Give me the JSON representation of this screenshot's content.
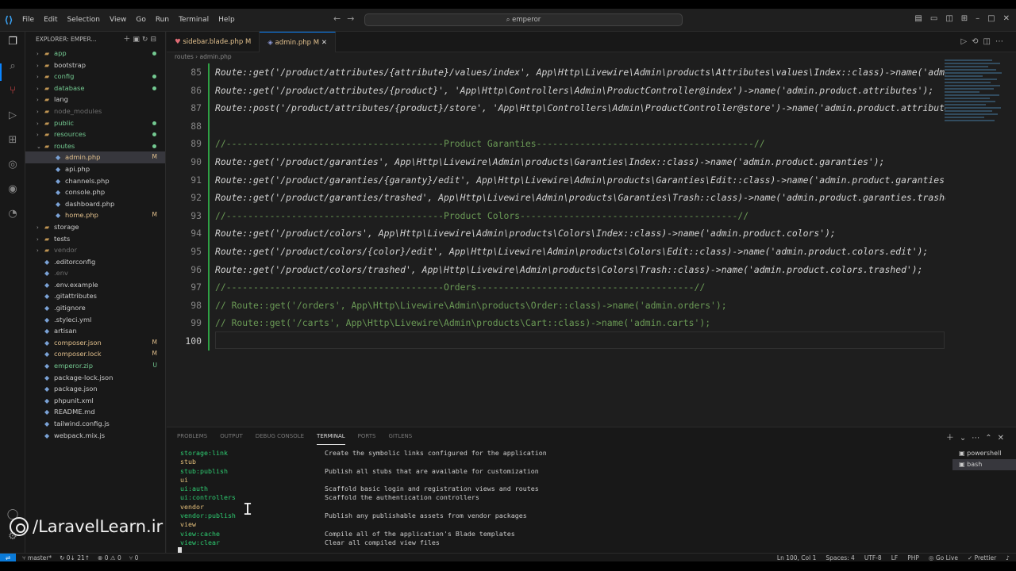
{
  "titlebar": {
    "menu": [
      "File",
      "Edit",
      "Selection",
      "View",
      "Go",
      "Run",
      "Terminal",
      "Help"
    ],
    "command_center": "emperor"
  },
  "explorer": {
    "title": "EXPLORER: EMPER...",
    "items": [
      {
        "label": "app",
        "kind": "folder",
        "color": "#73c991",
        "dot": true
      },
      {
        "label": "bootstrap",
        "kind": "folder",
        "color": "#cccccc"
      },
      {
        "label": "config",
        "kind": "folder",
        "color": "#73c991",
        "dot": true
      },
      {
        "label": "database",
        "kind": "folder",
        "color": "#73c991",
        "dot": true
      },
      {
        "label": "lang",
        "kind": "folder",
        "color": "#cccccc"
      },
      {
        "label": "node_modules",
        "kind": "folder",
        "color": "#6e6e6e"
      },
      {
        "label": "public",
        "kind": "folder",
        "color": "#73c991",
        "dot": true
      },
      {
        "label": "resources",
        "kind": "folder",
        "color": "#73c991",
        "dot": true
      },
      {
        "label": "routes",
        "kind": "folder-open",
        "color": "#73c991",
        "dot": true
      },
      {
        "label": "admin.php",
        "kind": "file",
        "color": "#e2c08d",
        "badge": "M",
        "selected": true,
        "indent": 1
      },
      {
        "label": "api.php",
        "kind": "file",
        "color": "#cccccc",
        "indent": 1
      },
      {
        "label": "channels.php",
        "kind": "file",
        "color": "#cccccc",
        "indent": 1
      },
      {
        "label": "console.php",
        "kind": "file",
        "color": "#cccccc",
        "indent": 1
      },
      {
        "label": "dashboard.php",
        "kind": "file",
        "color": "#cccccc",
        "indent": 1
      },
      {
        "label": "home.php",
        "kind": "file",
        "color": "#e2c08d",
        "badge": "M",
        "indent": 1
      },
      {
        "label": "storage",
        "kind": "folder",
        "color": "#cccccc"
      },
      {
        "label": "tests",
        "kind": "folder",
        "color": "#cccccc"
      },
      {
        "label": "vendor",
        "kind": "folder",
        "color": "#6e6e6e"
      },
      {
        "label": ".editorconfig",
        "kind": "file",
        "color": "#cccccc"
      },
      {
        "label": ".env",
        "kind": "file",
        "color": "#6e6e6e"
      },
      {
        "label": ".env.example",
        "kind": "file",
        "color": "#cccccc"
      },
      {
        "label": ".gitattributes",
        "kind": "file",
        "color": "#cccccc"
      },
      {
        "label": ".gitignore",
        "kind": "file",
        "color": "#cccccc"
      },
      {
        "label": ".styleci.yml",
        "kind": "file",
        "color": "#cccccc"
      },
      {
        "label": "artisan",
        "kind": "file",
        "color": "#cccccc"
      },
      {
        "label": "composer.json",
        "kind": "file",
        "color": "#e2c08d",
        "badge": "M"
      },
      {
        "label": "composer.lock",
        "kind": "file",
        "color": "#e2c08d",
        "badge": "M"
      },
      {
        "label": "emperor.zip",
        "kind": "file",
        "color": "#73c991",
        "badge": "U"
      },
      {
        "label": "package-lock.json",
        "kind": "file",
        "color": "#cccccc"
      },
      {
        "label": "package.json",
        "kind": "file",
        "color": "#cccccc"
      },
      {
        "label": "phpunit.xml",
        "kind": "file",
        "color": "#cccccc"
      },
      {
        "label": "README.md",
        "kind": "file",
        "color": "#cccccc"
      },
      {
        "label": "tailwind.config.js",
        "kind": "file",
        "color": "#cccccc"
      },
      {
        "label": "webpack.mix.js",
        "kind": "file",
        "color": "#cccccc"
      }
    ]
  },
  "tabs": [
    {
      "label": "sidebar.blade.php",
      "badge": "M",
      "active": false
    },
    {
      "label": "admin.php",
      "badge": "M",
      "active": true
    }
  ],
  "breadcrumb": "routes  ›  admin.php",
  "code": {
    "lines": [
      {
        "n": "85",
        "t": "Route::get('/product/attributes/{attribute}/values/index', App\\Http\\Livewire\\Admin\\products\\Attributes\\values\\Index::class)->name('admin.product.attributes.values.index');",
        "cm": false
      },
      {
        "n": "86",
        "t": "Route::get('/product/attributes/{product}', 'App\\Http\\Controllers\\Admin\\ProductController@index')->name('admin.product.attributes');",
        "cm": false
      },
      {
        "n": "87",
        "t": "Route::post('/product/attributes/{product}/store', 'App\\Http\\Controllers\\Admin\\ProductController@store')->name('admin.product.attributes.store');",
        "cm": false
      },
      {
        "n": "88",
        "t": "",
        "cm": false
      },
      {
        "n": "89",
        "t": "//----------------------------------------Product Garanties----------------------------------------//",
        "cm": true
      },
      {
        "n": "90",
        "t": "Route::get('/product/garanties', App\\Http\\Livewire\\Admin\\products\\Garanties\\Index::class)->name('admin.product.garanties');",
        "cm": false
      },
      {
        "n": "91",
        "t": "Route::get('/product/garanties/{garanty}/edit', App\\Http\\Livewire\\Admin\\products\\Garanties\\Edit::class)->name('admin.product.garanties.edit');",
        "cm": false
      },
      {
        "n": "92",
        "t": "Route::get('/product/garanties/trashed', App\\Http\\Livewire\\Admin\\products\\Garanties\\Trash::class)->name('admin.product.garanties.trashed');",
        "cm": false
      },
      {
        "n": "93",
        "t": "//----------------------------------------Product Colors----------------------------------------//",
        "cm": true
      },
      {
        "n": "94",
        "t": "Route::get('/product/colors', App\\Http\\Livewire\\Admin\\products\\Colors\\Index::class)->name('admin.product.colors');",
        "cm": false
      },
      {
        "n": "95",
        "t": "Route::get('/product/colors/{color}/edit', App\\Http\\Livewire\\Admin\\products\\Colors\\Edit::class)->name('admin.product.colors.edit');",
        "cm": false
      },
      {
        "n": "96",
        "t": "Route::get('/product/colors/trashed', App\\Http\\Livewire\\Admin\\products\\Colors\\Trash::class)->name('admin.product.colors.trashed');",
        "cm": false
      },
      {
        "n": "97",
        "t": "//----------------------------------------Orders----------------------------------------//",
        "cm": true
      },
      {
        "n": "98",
        "t": "// Route::get('/orders', App\\Http\\Livewire\\Admin\\products\\Order::class)->name('admin.orders');",
        "cm": true
      },
      {
        "n": "99",
        "t": "// Route::get('/carts', App\\Http\\Livewire\\Admin\\products\\Cart::class)->name('admin.carts');",
        "cm": true
      },
      {
        "n": "100",
        "t": "",
        "cm": false
      }
    ]
  },
  "panel": {
    "tabs": [
      "PROBLEMS",
      "OUTPUT",
      "DEBUG CONSOLE",
      "TERMINAL",
      "PORTS",
      "GITLENS"
    ],
    "active_tab": "TERMINAL",
    "sessions": [
      "powershell",
      "bash"
    ],
    "terminal_rows": [
      {
        "cmd": "  storage:link",
        "desc": "Create the symbolic links configured for the application",
        "group": false
      },
      {
        "cmd": " stub",
        "desc": "",
        "group": true
      },
      {
        "cmd": "  stub:publish",
        "desc": "Publish all stubs that are available for customization",
        "group": false
      },
      {
        "cmd": " ui",
        "desc": "",
        "group": true
      },
      {
        "cmd": "  ui:auth",
        "desc": "Scaffold basic login and registration views and routes",
        "group": false
      },
      {
        "cmd": "  ui:controllers",
        "desc": "Scaffold the authentication controllers",
        "group": false
      },
      {
        "cmd": " vendor",
        "desc": "",
        "group": true
      },
      {
        "cmd": "  vendor:publish",
        "desc": "Publish any publishable assets from vendor packages",
        "group": false
      },
      {
        "cmd": " view",
        "desc": "",
        "group": true
      },
      {
        "cmd": "  view:cache",
        "desc": "Compile all of the application's Blade templates",
        "group": false
      },
      {
        "cmd": "  view:clear",
        "desc": "Clear all compiled view files",
        "group": false
      }
    ]
  },
  "statusbar": {
    "branch": "master*",
    "sync": "0↓ 21↑",
    "errors": "⊗ 0 ⚠ 0",
    "ports": "⑂ 0",
    "right": [
      "Ln 100, Col 1",
      "Spaces: 4",
      "UTF-8",
      "LF",
      "PHP",
      "Go Live",
      "Prettier"
    ]
  },
  "watermark": "/LaravelLearn.ir"
}
